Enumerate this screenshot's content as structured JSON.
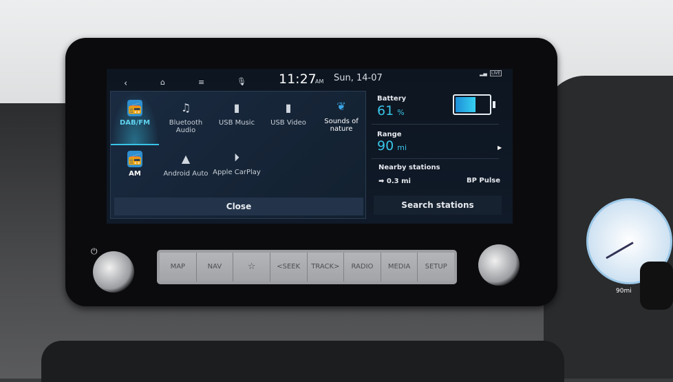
{
  "status_bar": {
    "time": "11:27",
    "ampm": "AM",
    "date": "Sun, 14-07",
    "live_badge": "LIVE"
  },
  "media_menu": {
    "items": [
      {
        "label": "DAB/FM",
        "icon": "radio-icon",
        "selected": true
      },
      {
        "label": "Bluetooth Audio",
        "icon": "bluetooth-audio-icon"
      },
      {
        "label": "USB Music",
        "icon": "usb-music-icon"
      },
      {
        "label": "USB Video",
        "icon": "usb-video-icon"
      },
      {
        "label": "Sounds of nature",
        "icon": "leaf-music-icon"
      },
      {
        "label": "AM",
        "icon": "radio-icon"
      },
      {
        "label": "Android Auto",
        "icon": "android-auto-icon"
      },
      {
        "label": "Apple CarPlay",
        "icon": "carplay-icon"
      }
    ],
    "close_label": "Close"
  },
  "ev_panel": {
    "battery_label": "Battery",
    "battery_value": "61",
    "battery_unit": "%",
    "battery_level": 61,
    "range_label": "Range",
    "range_value": "90",
    "range_unit": "mi",
    "nearby_label": "Nearby stations",
    "nearby_distance": "0.3 mi",
    "nearby_name": "BP Pulse",
    "search_label": "Search stations"
  },
  "hard_buttons": [
    "MAP",
    "NAV",
    "☆",
    "<SEEK",
    "TRACK>",
    "RADIO",
    "MEDIA",
    "SETUP"
  ],
  "cluster": {
    "range_readout": "90mi"
  },
  "colors": {
    "accent": "#39c5e8",
    "screen_bg": "#101a28"
  }
}
